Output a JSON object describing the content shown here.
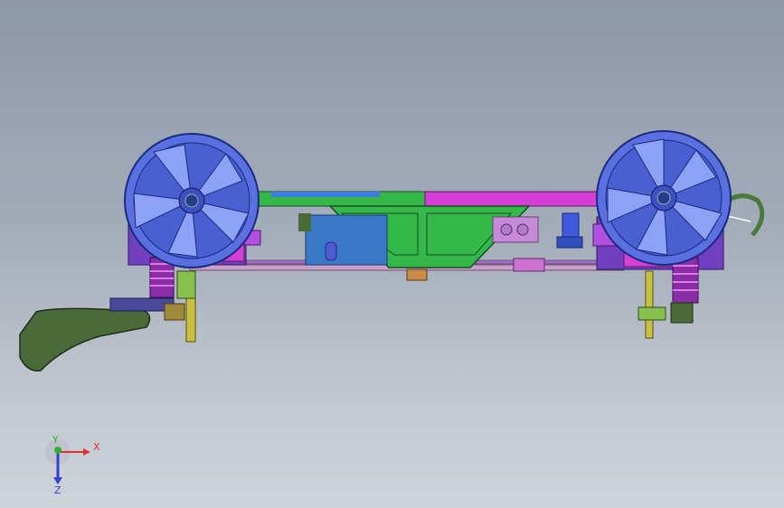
{
  "viewport": {
    "background_top": "#8d98a8",
    "background_bottom": "#cfd4db"
  },
  "model": {
    "part_colors": {
      "wheel": "#5a6fe0",
      "wheel_spoke": "#8ea2f5",
      "frame_green": "#34b84a",
      "frame_magenta": "#d63fd6",
      "beam_blue": "#3f7fe0",
      "spring": "#8a2ea8",
      "mud_flap": "#4a6a3a",
      "motor": "#3a78c8"
    }
  },
  "triad": {
    "x_label": "X",
    "y_label": "Y",
    "z_label": "Z",
    "x_color": "#e03030",
    "y_color": "#30b030",
    "z_color": "#3040d0"
  }
}
